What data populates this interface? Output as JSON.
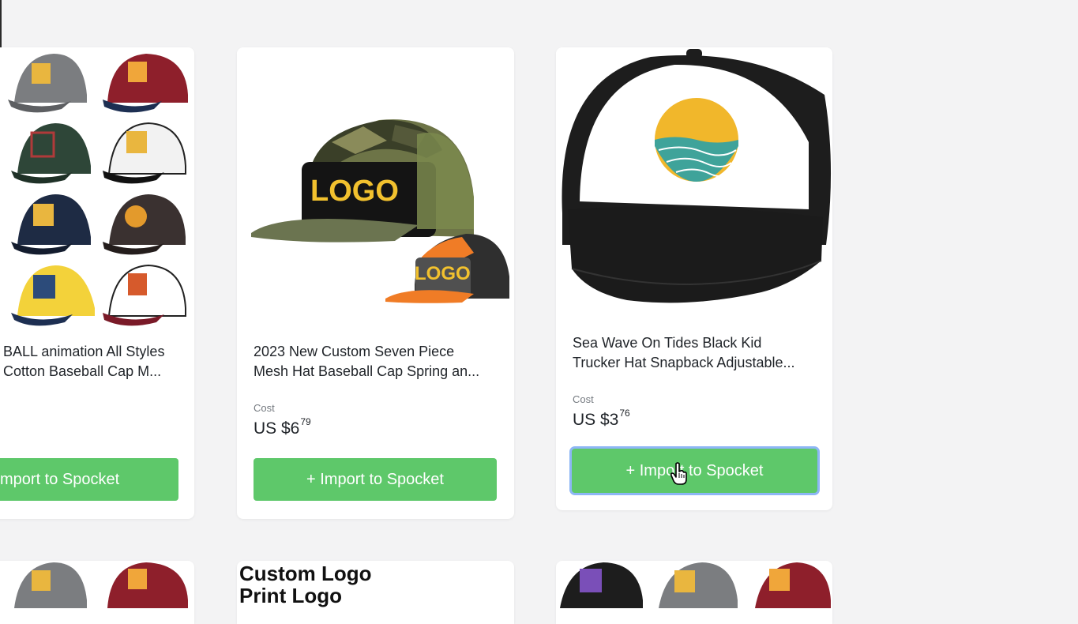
{
  "products": [
    {
      "title_lines": [
        "BALL animation All Styles",
        "Cotton Baseball Cap M..."
      ],
      "cost_label": "",
      "price_main": "",
      "price_cents": "",
      "button_label": "mport to Spocket"
    },
    {
      "title_lines": [
        "2023 New Custom Seven Piece",
        "Mesh Hat Baseball Cap Spring an..."
      ],
      "cost_label": "Cost",
      "price_main": "US $6",
      "price_cents": "79",
      "button_label": "+ Import to Spocket",
      "image_logo_text": "LOGO"
    },
    {
      "title_lines": [
        "Sea Wave On Tides Black Kid",
        "Trucker Hat Snapback Adjustable..."
      ],
      "cost_label": "Cost",
      "price_main": "US $3",
      "price_cents": "76",
      "button_label": "+ Import to Spocket"
    }
  ],
  "next_row": {
    "custom_lines": [
      "Custom Logo",
      "Print Logo"
    ]
  },
  "colors": {
    "accent_green": "#5ec86a",
    "focus_ring": "#8db6f5",
    "page_bg": "#f3f3f4"
  },
  "icons": [
    "hand-pointer-cursor-icon"
  ]
}
